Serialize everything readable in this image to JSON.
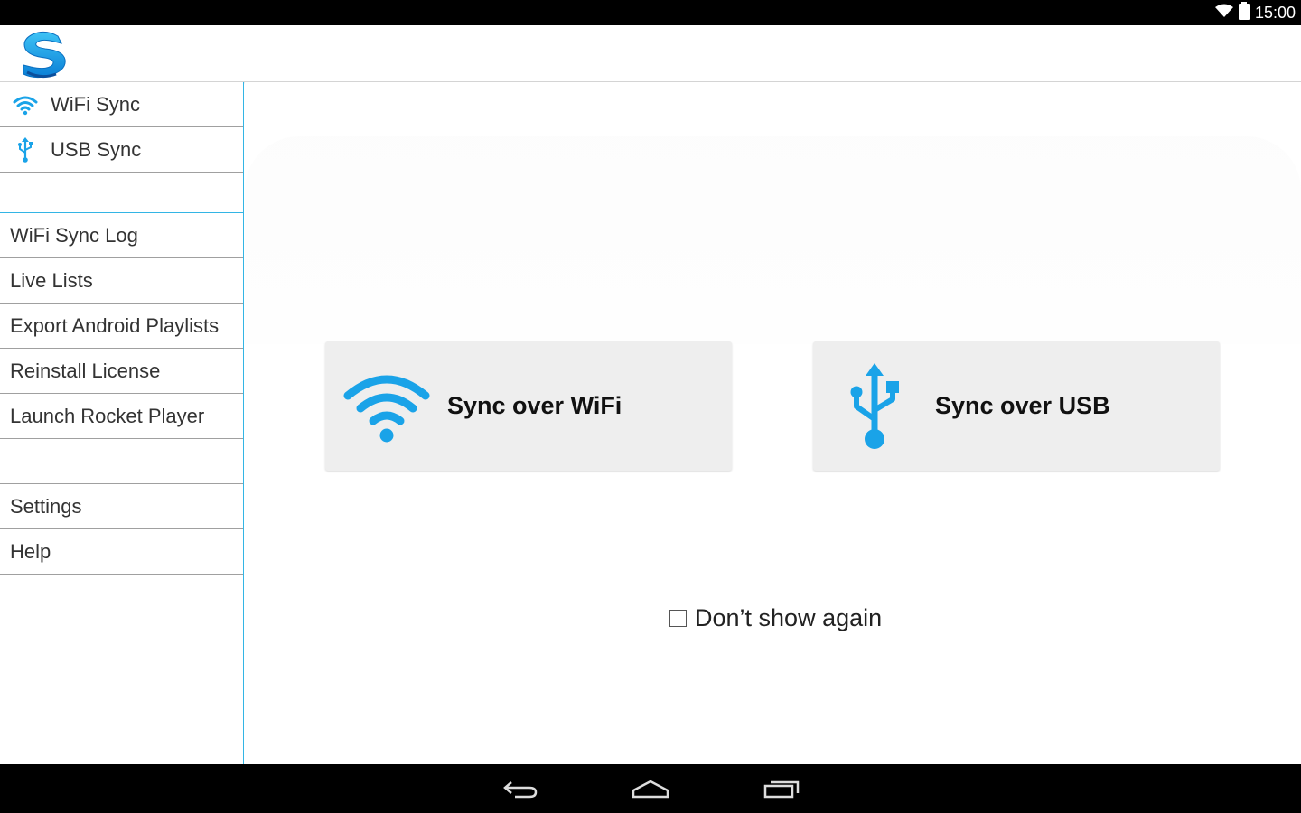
{
  "status_bar": {
    "time": "15:00",
    "icons": [
      "wifi-signal-icon",
      "battery-icon"
    ]
  },
  "app": {
    "logo": "app-logo-s-icon"
  },
  "sidebar": {
    "top_items": [
      {
        "label": "WiFi Sync",
        "icon": "wifi-icon"
      },
      {
        "label": "USB Sync",
        "icon": "usb-icon"
      }
    ],
    "items": [
      {
        "label": "WiFi Sync Log"
      },
      {
        "label": "Live Lists"
      },
      {
        "label": "Export Android Playlists"
      },
      {
        "label": "Reinstall License"
      },
      {
        "label": "Launch Rocket Player"
      }
    ],
    "bottom_items": [
      {
        "label": "Settings"
      },
      {
        "label": "Help"
      }
    ]
  },
  "main": {
    "wifi_button": {
      "label": "Sync over WiFi",
      "icon": "wifi-icon"
    },
    "usb_button": {
      "label": "Sync over USB",
      "icon": "usb-icon"
    },
    "dont_show_again": {
      "label": "Don’t show again",
      "checked": false
    }
  },
  "navigation_bar": {
    "buttons": [
      "back-icon",
      "home-icon",
      "recent-apps-icon"
    ]
  },
  "colors": {
    "accent": "#33b5e5",
    "icon_blue": "#1aa3e8",
    "card_bg": "#eeeeee"
  }
}
